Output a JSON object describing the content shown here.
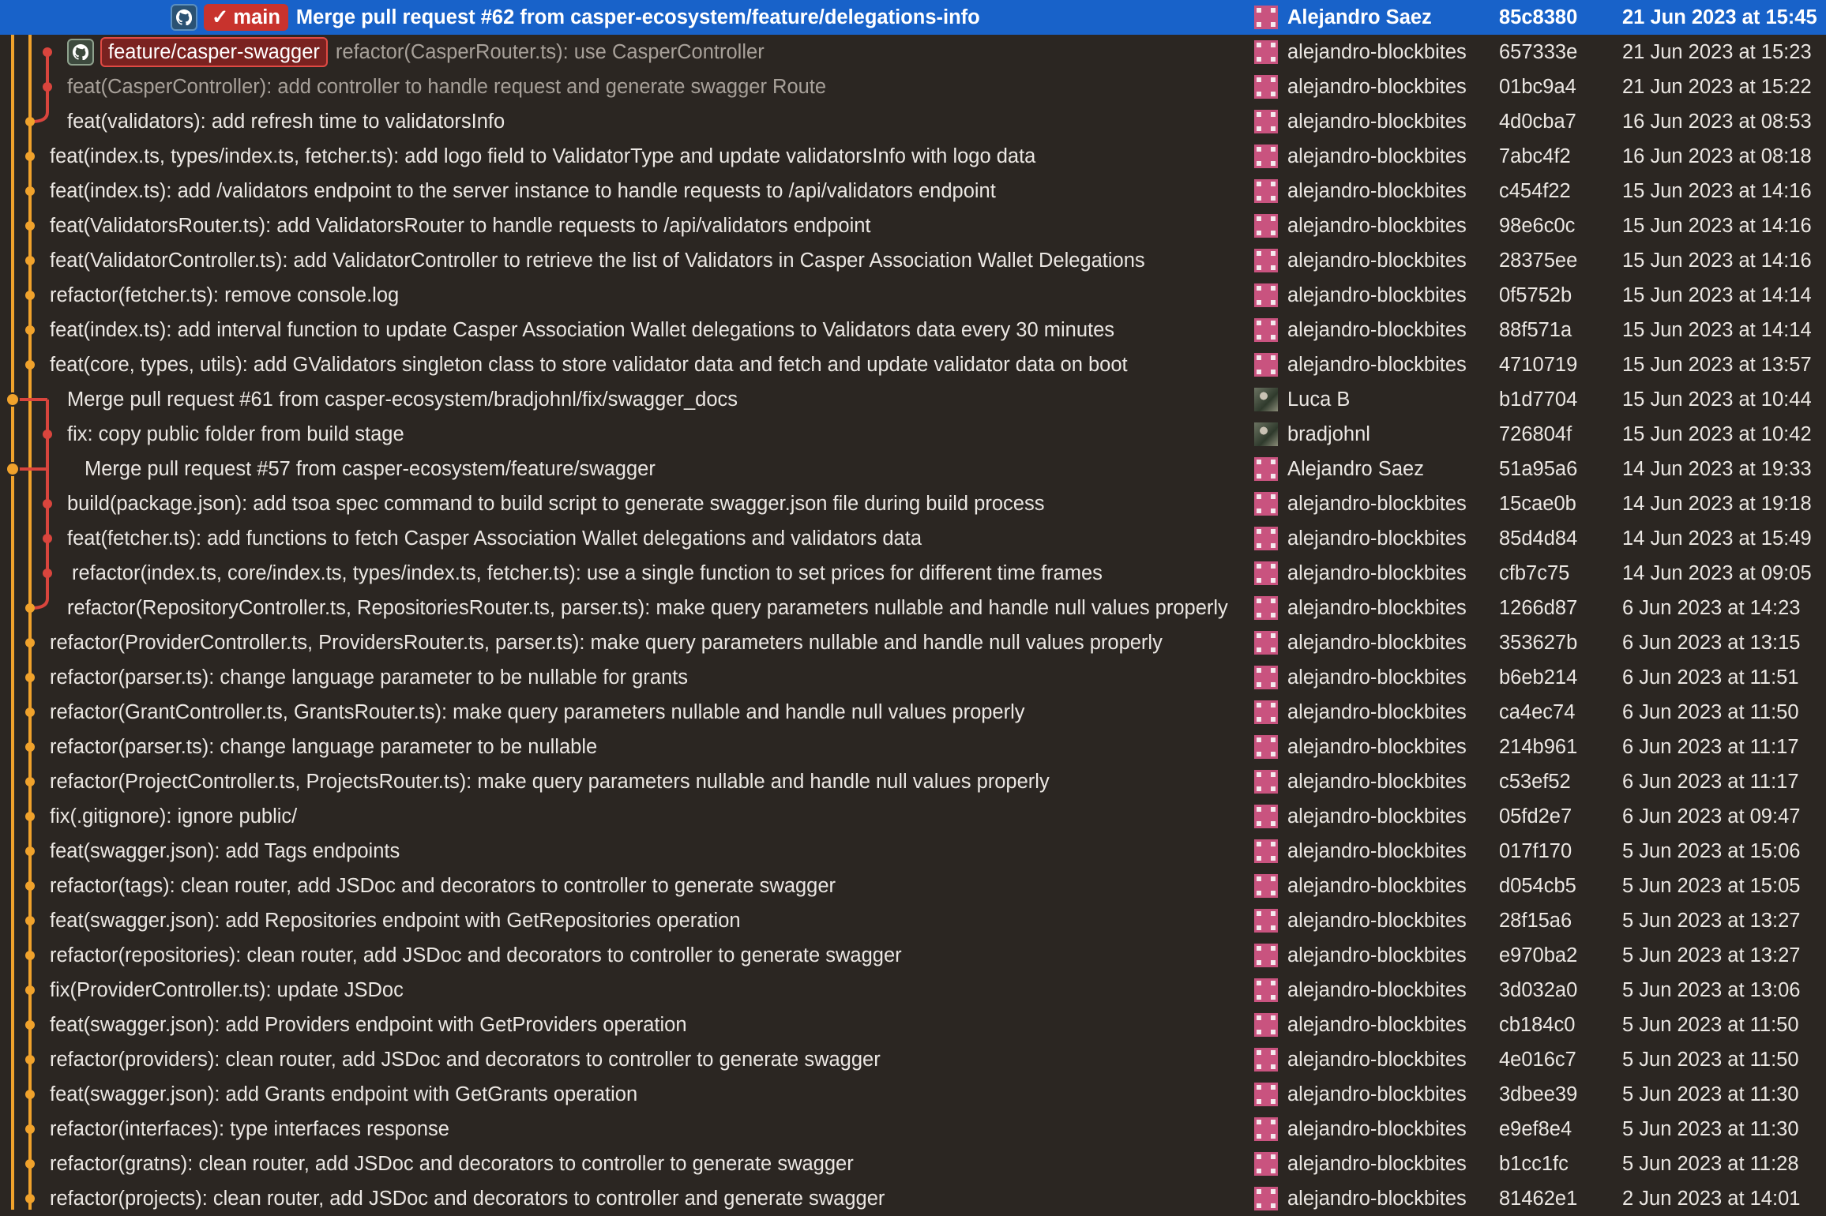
{
  "colors": {
    "head_row": "#1862c9",
    "background": "#2b2622",
    "graph_main": "#f0a22c",
    "graph_branch": "#d9453d",
    "branch_main_badge": "#c8332d",
    "branch_feature_badge": "#7a2220"
  },
  "commits": [
    {
      "msg": "Merge pull request #62 from casper-ecosystem/feature/delegations-info",
      "author": "Alejandro Saez",
      "hash": "85c8380",
      "date": "21 Jun 2023 at 15:45",
      "avatar": "pixel-avatar",
      "badges": [
        "github-icon",
        "main"
      ],
      "head": true
    },
    {
      "msg": "refactor(CasperRouter.ts): use CasperController",
      "author": "alejandro-blockbites",
      "hash": "657333e",
      "date": "21 Jun 2023 at 15:23",
      "avatar": "pixel-avatar",
      "badges": [
        "github-icon",
        "feature/casper-swagger"
      ],
      "dim": true
    },
    {
      "msg": "feat(CasperController): add controller to handle request and generate swagger Route",
      "author": "alejandro-blockbites",
      "hash": "01bc9a4",
      "date": "21 Jun 2023 at 15:22",
      "avatar": "pixel-avatar",
      "dim": true
    },
    {
      "msg": "feat(validators): add refresh time to validatorsInfo",
      "author": "alejandro-blockbites",
      "hash": "4d0cba7",
      "date": "16 Jun 2023 at 08:53",
      "avatar": "pixel-avatar"
    },
    {
      "msg": "feat(index.ts, types/index.ts, fetcher.ts): add logo field to ValidatorType and update validatorsInfo with logo data",
      "author": "alejandro-blockbites",
      "hash": "7abc4f2",
      "date": "16 Jun 2023 at 08:18",
      "avatar": "pixel-avatar"
    },
    {
      "msg": "feat(index.ts): add /validators endpoint to the server instance to handle requests to /api/validators endpoint",
      "author": "alejandro-blockbites",
      "hash": "c454f22",
      "date": "15 Jun 2023 at 14:16",
      "avatar": "pixel-avatar"
    },
    {
      "msg": "feat(ValidatorsRouter.ts): add ValidatorsRouter to handle requests to /api/validators endpoint",
      "author": "alejandro-blockbites",
      "hash": "98e6c0c",
      "date": "15 Jun 2023 at 14:16",
      "avatar": "pixel-avatar"
    },
    {
      "msg": "feat(ValidatorController.ts): add ValidatorController to retrieve the list of Validators in Casper Association Wallet Delegations",
      "author": "alejandro-blockbites",
      "hash": "28375ee",
      "date": "15 Jun 2023 at 14:16",
      "avatar": "pixel-avatar"
    },
    {
      "msg": "refactor(fetcher.ts): remove console.log",
      "author": "alejandro-blockbites",
      "hash": "0f5752b",
      "date": "15 Jun 2023 at 14:14",
      "avatar": "pixel-avatar"
    },
    {
      "msg": "feat(index.ts): add interval function to update Casper Association Wallet delegations to Validators data every 30 minutes",
      "author": "alejandro-blockbites",
      "hash": "88f571a",
      "date": "15 Jun 2023 at 14:14",
      "avatar": "pixel-avatar"
    },
    {
      "msg": "feat(core, types, utils): add GValidators singleton class to store validator data and fetch and update validator data on boot",
      "author": "alejandro-blockbites",
      "hash": "4710719",
      "date": "15 Jun 2023 at 13:57",
      "avatar": "pixel-avatar"
    },
    {
      "msg": "Merge pull request #61 from casper-ecosystem/bradjohnl/fix/swagger_docs",
      "author": "Luca B",
      "hash": "b1d7704",
      "date": "15 Jun 2023 at 10:44",
      "avatar": "photo-avatar"
    },
    {
      "msg": "fix: copy public folder from build stage",
      "author": "bradjohnl",
      "hash": "726804f",
      "date": "15 Jun 2023 at 10:42",
      "avatar": "photo-avatar"
    },
    {
      "msg": "Merge pull request #57 from casper-ecosystem/feature/swagger",
      "author": "Alejandro Saez",
      "hash": "51a95a6",
      "date": "14 Jun 2023 at 19:33",
      "avatar": "pixel-avatar"
    },
    {
      "msg": "build(package.json): add tsoa spec command to build script to generate swagger.json file during build process",
      "author": "alejandro-blockbites",
      "hash": "15cae0b",
      "date": "14 Jun 2023 at 19:18",
      "avatar": "pixel-avatar"
    },
    {
      "msg": "feat(fetcher.ts): add functions to fetch Casper Association Wallet delegations and validators data",
      "author": "alejandro-blockbites",
      "hash": "85d4d84",
      "date": "14 Jun 2023 at 15:49",
      "avatar": "pixel-avatar"
    },
    {
      "msg": "refactor(index.ts, core/index.ts, types/index.ts, fetcher.ts): use a single function to set prices for different time frames",
      "author": "alejandro-blockbites",
      "hash": "cfb7c75",
      "date": "14 Jun 2023 at 09:05",
      "avatar": "pixel-avatar"
    },
    {
      "msg": "refactor(RepositoryController.ts, RepositoriesRouter.ts, parser.ts): make query parameters nullable and handle null values properly",
      "author": "alejandro-blockbites",
      "hash": "1266d87",
      "date": "6 Jun 2023 at 14:23",
      "avatar": "pixel-avatar"
    },
    {
      "msg": "refactor(ProviderController.ts, ProvidersRouter.ts, parser.ts): make query parameters nullable and handle null values properly",
      "author": "alejandro-blockbites",
      "hash": "353627b",
      "date": "6 Jun 2023 at 13:15",
      "avatar": "pixel-avatar"
    },
    {
      "msg": "refactor(parser.ts): change language parameter to be nullable for grants",
      "author": "alejandro-blockbites",
      "hash": "b6eb214",
      "date": "6 Jun 2023 at 11:51",
      "avatar": "pixel-avatar"
    },
    {
      "msg": "refactor(GrantController.ts, GrantsRouter.ts): make query parameters nullable and handle null values properly",
      "author": "alejandro-blockbites",
      "hash": "ca4ec74",
      "date": "6 Jun 2023 at 11:50",
      "avatar": "pixel-avatar"
    },
    {
      "msg": "refactor(parser.ts): change language parameter to be nullable",
      "author": "alejandro-blockbites",
      "hash": "214b961",
      "date": "6 Jun 2023 at 11:17",
      "avatar": "pixel-avatar"
    },
    {
      "msg": "refactor(ProjectController.ts, ProjectsRouter.ts): make query parameters nullable and handle null values properly",
      "author": "alejandro-blockbites",
      "hash": "c53ef52",
      "date": "6 Jun 2023 at 11:17",
      "avatar": "pixel-avatar"
    },
    {
      "msg": "fix(.gitignore): ignore public/",
      "author": "alejandro-blockbites",
      "hash": "05fd2e7",
      "date": "6 Jun 2023 at 09:47",
      "avatar": "pixel-avatar"
    },
    {
      "msg": "feat(swagger.json): add Tags endpoints",
      "author": "alejandro-blockbites",
      "hash": "017f170",
      "date": "5 Jun 2023 at 15:06",
      "avatar": "pixel-avatar"
    },
    {
      "msg": "refactor(tags): clean router, add JSDoc and decorators to controller to generate swagger",
      "author": "alejandro-blockbites",
      "hash": "d054cb5",
      "date": "5 Jun 2023 at 15:05",
      "avatar": "pixel-avatar"
    },
    {
      "msg": "feat(swagger.json): add Repositories endpoint with GetRepositories  operation",
      "author": "alejandro-blockbites",
      "hash": "28f15a6",
      "date": "5 Jun 2023 at 13:27",
      "avatar": "pixel-avatar"
    },
    {
      "msg": "refactor(repositories): clean router, add JSDoc and decorators to controller to generate swagger",
      "author": "alejandro-blockbites",
      "hash": "e970ba2",
      "date": "5 Jun 2023 at 13:27",
      "avatar": "pixel-avatar"
    },
    {
      "msg": "fix(ProviderController.ts): update JSDoc",
      "author": "alejandro-blockbites",
      "hash": "3d032a0",
      "date": "5 Jun 2023 at 13:06",
      "avatar": "pixel-avatar"
    },
    {
      "msg": "feat(swagger.json): add Providers endpoint with GetProviders operation",
      "author": "alejandro-blockbites",
      "hash": "cb184c0",
      "date": "5 Jun 2023 at 11:50",
      "avatar": "pixel-avatar"
    },
    {
      "msg": "refactor(providers): clean router, add JSDoc and decorators to controller to generate swagger",
      "author": "alejandro-blockbites",
      "hash": "4e016c7",
      "date": "5 Jun 2023 at 11:50",
      "avatar": "pixel-avatar"
    },
    {
      "msg": "feat(swagger.json): add Grants endpoint with GetGrants operation",
      "author": "alejandro-blockbites",
      "hash": "3dbee39",
      "date": "5 Jun 2023 at 11:30",
      "avatar": "pixel-avatar"
    },
    {
      "msg": "refactor(interfaces): type interfaces response",
      "author": "alejandro-blockbites",
      "hash": "e9ef8e4",
      "date": "5 Jun 2023 at 11:30",
      "avatar": "pixel-avatar"
    },
    {
      "msg": "refactor(gratns): clean router, add JSDoc and decorators to controller to generate swagger",
      "author": "alejandro-blockbites",
      "hash": "b1cc1fc",
      "date": "5 Jun 2023 at 11:28",
      "avatar": "pixel-avatar"
    },
    {
      "msg": "refactor(projects): clean router, add JSDoc and decorators to controller and generate swagger",
      "author": "alejandro-blockbites",
      "hash": "81462e1",
      "date": "2 Jun 2023 at 14:01",
      "avatar": "pixel-avatar"
    }
  ]
}
